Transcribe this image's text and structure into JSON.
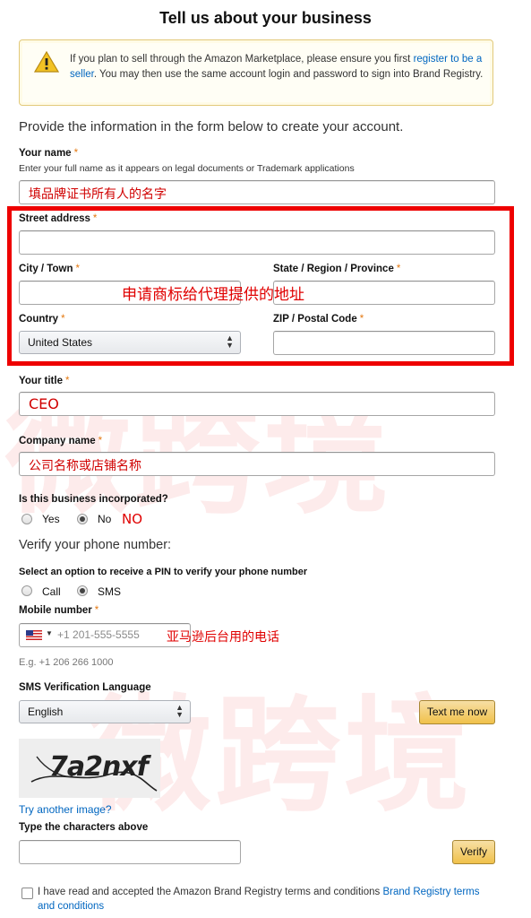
{
  "page": {
    "title": "Tell us about your business",
    "intro": "Provide the information in the form below to create your account."
  },
  "alert": {
    "text_before": "If you plan to sell through the Amazon Marketplace, please ensure you first ",
    "link": "register to be a seller",
    "text_after": ". You may then use the same account login and password to sign into Brand Registry."
  },
  "form": {
    "required_mark": "*",
    "your_name": {
      "label": "Your name",
      "hint": "Enter your full name as it appears on legal documents or Trademark applications",
      "value": "填品牌证书所有人的名字"
    },
    "street_address": {
      "label": "Street address",
      "value": ""
    },
    "city": {
      "label": "City / Town",
      "value": ""
    },
    "state": {
      "label": "State / Region / Province",
      "value": ""
    },
    "address_note": "申请商标给代理提供的地址",
    "country": {
      "label": "Country",
      "value": "United States"
    },
    "zip": {
      "label": "ZIP / Postal Code",
      "value": ""
    },
    "your_title": {
      "label": "Your title",
      "value": "CEO"
    },
    "company_name": {
      "label": "Company name",
      "value": "公司名称或店铺名称"
    },
    "incorporated": {
      "label": "Is this business incorporated?",
      "options": [
        "Yes",
        "No"
      ],
      "selected": "No",
      "note": "NO"
    }
  },
  "phone": {
    "heading": "Verify your phone number:",
    "pin_label": "Select an option to receive a PIN to verify your phone number",
    "options": [
      "Call",
      "SMS"
    ],
    "selected": "SMS",
    "mobile": {
      "label": "Mobile number",
      "placeholder": "+1 201-555-5555",
      "example": "E.g. +1 206 266 1000",
      "note": "亚马逊后台用的电话"
    },
    "language": {
      "label": "SMS Verification Language",
      "value": "English"
    },
    "text_me_button": "Text me now"
  },
  "captcha": {
    "image_text": "7a2nxf",
    "retry_link": "Try another image?",
    "label": "Type the characters above",
    "value": "",
    "verify_button": "Verify"
  },
  "terms": {
    "text": "I have read and accepted the Amazon Brand Registry terms and conditions ",
    "link": "Brand Registry terms and conditions"
  },
  "watermark": {
    "text": "微跨境"
  },
  "colors": {
    "required": "#e47911",
    "link": "#0066c0",
    "annotation_red": "#e00000",
    "button_yellow": "#f0c14b"
  },
  "icons": {
    "alert": "warning-triangle-icon",
    "select": "select-arrows-icon",
    "flag": "us-flag-icon"
  }
}
